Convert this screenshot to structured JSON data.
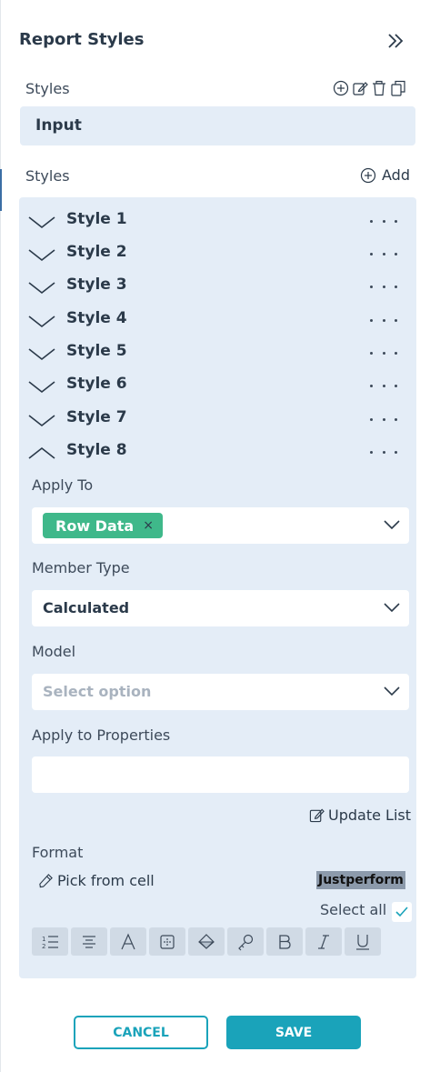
{
  "panel": {
    "title": "Report Styles",
    "collapse_icon": "double-chevron-right-icon"
  },
  "styles_section": {
    "label": "Styles",
    "selected_value": "Input",
    "icons": [
      "add-circle-icon",
      "edit-icon",
      "delete-icon",
      "copy-icon"
    ]
  },
  "styles_list": {
    "label": "Styles",
    "add_label": "Add",
    "items": [
      {
        "name": "Style 1",
        "expanded": false
      },
      {
        "name": "Style 2",
        "expanded": false
      },
      {
        "name": "Style 3",
        "expanded": false
      },
      {
        "name": "Style 4",
        "expanded": false
      },
      {
        "name": "Style 5",
        "expanded": false
      },
      {
        "name": "Style 6",
        "expanded": false
      },
      {
        "name": "Style 7",
        "expanded": false
      },
      {
        "name": "Style 8",
        "expanded": true
      }
    ]
  },
  "style_editor": {
    "apply_to": {
      "label": "Apply To",
      "tags": [
        "Row Data"
      ],
      "remove_symbol": "×"
    },
    "member_type": {
      "label": "Member Type",
      "value": "Calculated"
    },
    "model": {
      "label": "Model",
      "placeholder": "Select option"
    },
    "apply_to_properties": {
      "label": "Apply to Properties",
      "value": ""
    },
    "update_list_label": "Update List",
    "format": {
      "label": "Format",
      "pick_from_cell_label": "Pick from cell",
      "preview_text": "Justperform",
      "select_all_label": "Select all",
      "select_all_checked": true,
      "tools": [
        "numbered-list-icon",
        "align-center-icon",
        "font-icon",
        "border-icon",
        "fill-color-icon",
        "key-icon",
        "bold-icon",
        "italic-icon",
        "underline-icon"
      ]
    }
  },
  "footer": {
    "cancel_label": "CANCEL",
    "save_label": "SAVE"
  },
  "colors": {
    "accent": "#1aa3ba",
    "tag": "#3fb88a",
    "panel_bg": "#e4edf7",
    "text": "#2b3a4a"
  }
}
